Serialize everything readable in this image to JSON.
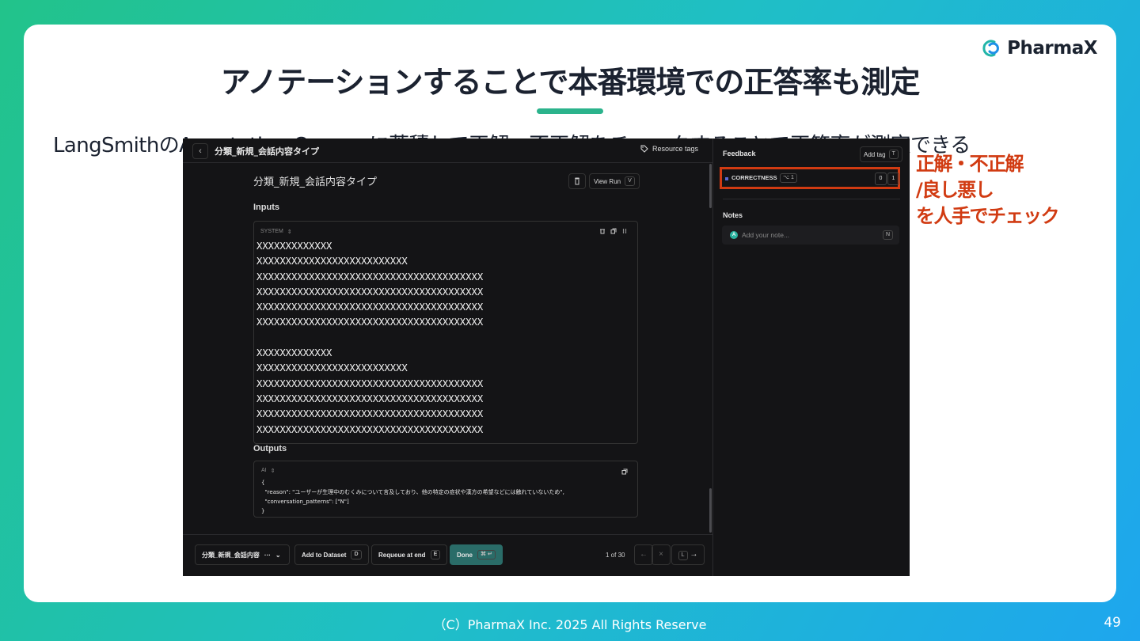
{
  "slide": {
    "brand": "PharmaX",
    "title": "アノテーションすることで本番環境での正答率も測定",
    "subtitle": "LangSmithのAnnotation Queuesに蓄積して正解・不正解をチェックすることで正答率が測定できる",
    "annotation_lines": [
      "正解・不正解",
      "/良し悪し",
      "を人手でチェック"
    ],
    "footer": "（C）PharmaX Inc. 2025  All Rights Reserve",
    "page_number": "49",
    "accent_color": "#2bb38c",
    "annotation_color": "#d13b12"
  },
  "app": {
    "breadcrumb": "分類_新規_会話内容タイプ",
    "resource_tags_label": "Resource tags",
    "run_title": "分類_新規_会話内容タイプ",
    "view_run_label": "View Run",
    "view_run_key": "V",
    "inputs_label": "Inputs",
    "system_role": "SYSTEM",
    "system_lines": "XXXXXXXXXXXXX\nXXXXXXXXXXXXXXXXXXXXXXXXXX\nXXXXXXXXXXXXXXXXXXXXXXXXXXXXXXXXXXXXXXX\nXXXXXXXXXXXXXXXXXXXXXXXXXXXXXXXXXXXXXXX\nXXXXXXXXXXXXXXXXXXXXXXXXXXXXXXXXXXXXXXX\nXXXXXXXXXXXXXXXXXXXXXXXXXXXXXXXXXXXXXXX\n\nXXXXXXXXXXXXX\nXXXXXXXXXXXXXXXXXXXXXXXXXX\nXXXXXXXXXXXXXXXXXXXXXXXXXXXXXXXXXXXXXXX\nXXXXXXXXXXXXXXXXXXXXXXXXXXXXXXXXXXXXXXX\nXXXXXXXXXXXXXXXXXXXXXXXXXXXXXXXXXXXXXXX\nXXXXXXXXXXXXXXXXXXXXXXXXXXXXXXXXXXXXXXX",
    "outputs_label": "Outputs",
    "output_role": "AI",
    "output_lines": "{\n  \"reason\": \"ユーザーが生理中のむくみについて言及しており、他の特定の症状や漢方の希望などには触れていないため\",\n  \"conversation_patterns\": [\"N\"]\n}",
    "queue_select_label": "分類_新規_会話内容",
    "add_to_dataset_label": "Add to Dataset",
    "add_to_dataset_key": "D",
    "requeue_label": "Requeue at end",
    "requeue_key": "E",
    "done_label": "Done",
    "done_key": "⌘ ↵",
    "pager_text": "1 of 30",
    "last_key": "L",
    "feedback_label": "Feedback",
    "add_tag_label": "Add tag",
    "add_tag_key": "T",
    "correctness_label": "CORRECTNESS",
    "correctness_key": "⌥ 1",
    "score_options": [
      "0",
      "1"
    ],
    "notes_label": "Notes",
    "avatar_initial": "A",
    "note_placeholder": "Add your note...",
    "note_key": "N"
  }
}
